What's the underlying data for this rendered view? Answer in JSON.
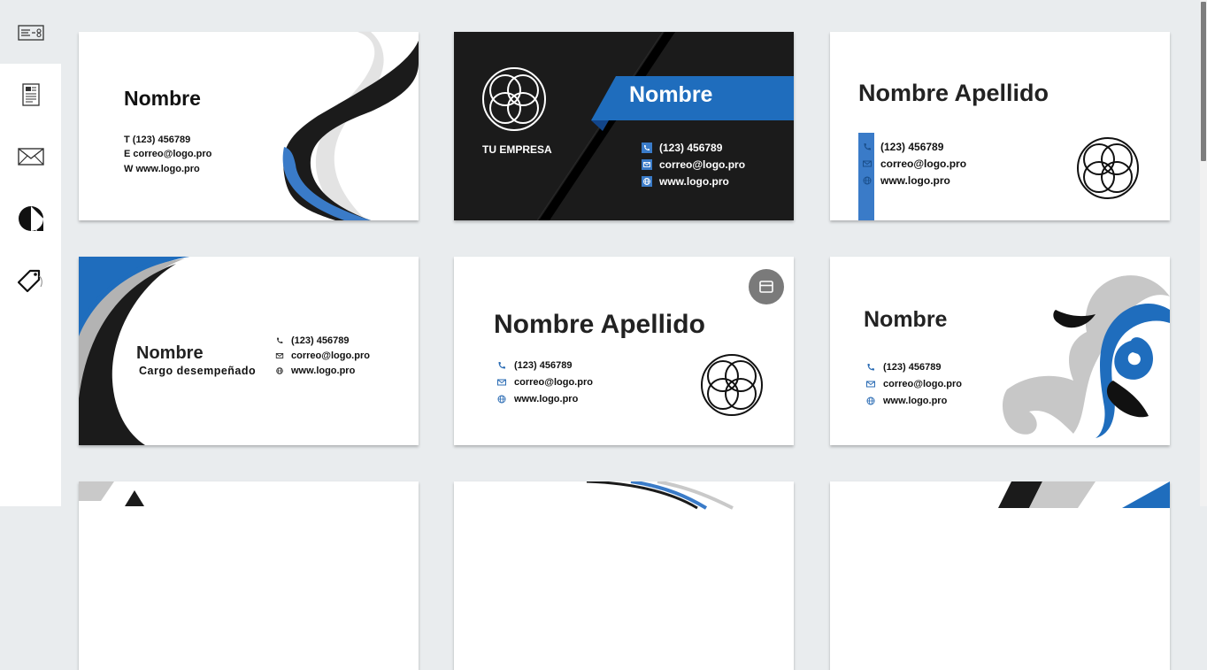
{
  "sidebar": {
    "items": [
      {
        "icon": "business-card-icon"
      },
      {
        "icon": "document-icon"
      },
      {
        "icon": "envelope-icon"
      },
      {
        "icon": "sticker-icon"
      },
      {
        "icon": "tag-icon"
      }
    ]
  },
  "cards": [
    {
      "name": "Nombre",
      "phone_line": "T (123) 456789",
      "email_line": "E correo@logo.pro",
      "web_line": "W www.logo.pro"
    },
    {
      "name": "Nombre",
      "company": "TU EMPRESA",
      "phone": "(123) 456789",
      "email": "correo@logo.pro",
      "web": "www.logo.pro"
    },
    {
      "name": "Nombre Apellido",
      "phone": "(123) 456789",
      "email": "correo@logo.pro",
      "web": "www.logo.pro"
    },
    {
      "name": "Nombre",
      "title": "Cargo desempeñado",
      "phone": "(123) 456789",
      "email": "correo@logo.pro",
      "web": "www.logo.pro"
    },
    {
      "name": "Nombre Apellido",
      "phone": "(123) 456789",
      "email": "correo@logo.pro",
      "web": "www.logo.pro",
      "badge_icon": "card-view-icon"
    },
    {
      "name": "Nombre",
      "phone": "(123) 456789",
      "email": "correo@logo.pro",
      "web": "www.logo.pro"
    }
  ],
  "colors": {
    "accent": "#3a7bc8",
    "dark": "#1b1b1b",
    "gray": "#c9c9c9",
    "bg": "#e9ecee"
  }
}
